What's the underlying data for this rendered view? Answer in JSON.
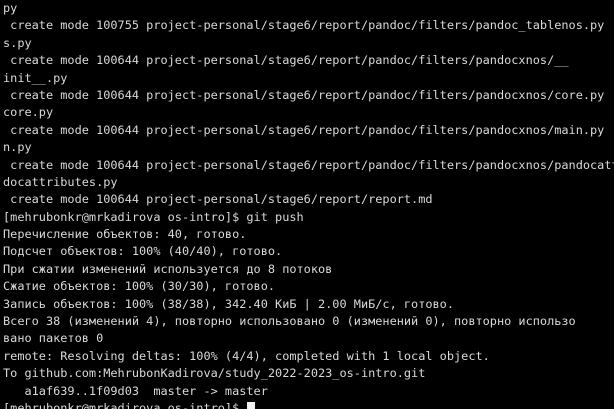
{
  "terminal": {
    "lines": [
      "py",
      " create mode 100755 project-personal/stage6/report/pandoc/filters/pandoc_tablenos.py",
      "s.py",
      " create mode 100644 project-personal/stage6/report/pandoc/filters/pandocxnos/__",
      "init__.py",
      " create mode 100644 project-personal/stage6/report/pandoc/filters/pandocxnos/core.py",
      "core.py",
      " create mode 100644 project-personal/stage6/report/pandoc/filters/pandocxnos/main.py",
      "n.py",
      " create mode 100644 project-personal/stage6/report/pandoc/filters/pandocxnos/pandocattributes.py",
      "docattributes.py",
      " create mode 100644 project-personal/stage6/report/report.md",
      "[mehrubonkr@mrkadirova os-intro]$ git push",
      "Перечисление объектов: 40, готово.",
      "Подсчет объектов: 100% (40/40), готово.",
      "При сжатии изменений используется до 8 потоков",
      "Сжатие объектов: 100% (30/30), готово.",
      "Запись объектов: 100% (38/38), 342.40 КиБ | 2.00 МиБ/с, готово.",
      "Всего 38 (изменений 4), повторно использовано 0 (изменений 0), повторно использо",
      "вано пакетов 0",
      "remote: Resolving deltas: 100% (4/4), completed with 1 local object.",
      "To github.com:MehrubonKadirova/study_2022-2023_os-intro.git",
      "   a1af639..1f09d03  master -> master"
    ],
    "prompt": "[mehrubonkr@mrkadirova os-intro]$ "
  }
}
